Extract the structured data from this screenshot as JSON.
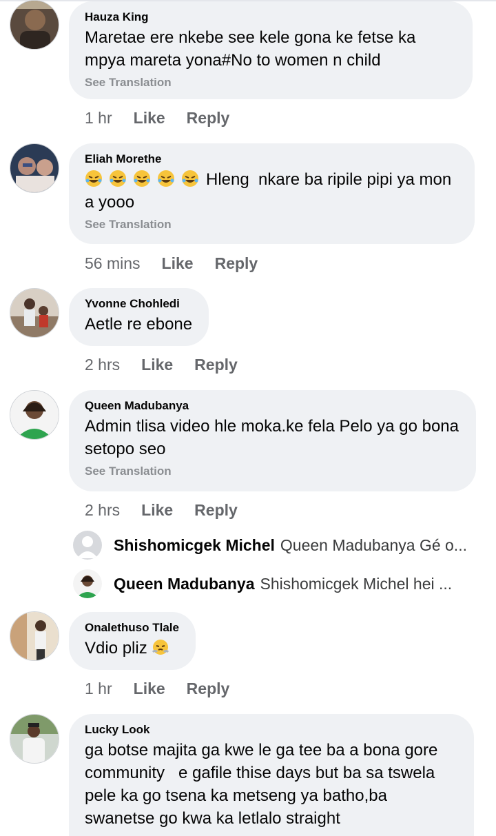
{
  "comments": [
    {
      "author": "Hauza King",
      "text": "Maretae ere nkebe see kele gona ke fetse ka mpya mareta yona#No to women n child",
      "see_translation": "See Translation",
      "time": "1 hr",
      "like": "Like",
      "reply": "Reply"
    },
    {
      "author": "Eliah Morethe",
      "emoji": [
        "rolling-on-floor-laughing",
        "rolling-on-floor-laughing",
        "rolling-on-floor-laughing",
        "rolling-on-floor-laughing",
        "rolling-on-floor-laughing"
      ],
      "text": "Hleng  nkare ba ripile pipi ya mon a yooo",
      "see_translation": "See Translation",
      "time": "56 mins",
      "like": "Like",
      "reply": "Reply"
    },
    {
      "author": "Yvonne Chohledi",
      "text": "Aetle re ebone",
      "time": "2 hrs",
      "like": "Like",
      "reply": "Reply"
    },
    {
      "author": "Queen Madubanya",
      "text": "Admin tlisa video hle moka.ke fela Pelo ya go bona setopo seo",
      "see_translation": "See Translation",
      "time": "2 hrs",
      "like": "Like",
      "reply": "Reply",
      "replies": [
        {
          "author": "Shishomicgek Michel",
          "text": "Queen Madubanya Gé o..."
        },
        {
          "author": "Queen Madubanya",
          "text": "Shishomicgek Michel hei ..."
        }
      ]
    },
    {
      "author": "Onalethuso Tlale",
      "text": "Vdio pliz",
      "emoji_after": "face-with-steam",
      "time": "1 hr",
      "like": "Like",
      "reply": "Reply"
    },
    {
      "author": "Lucky Look",
      "text": "ga botse majita ga kwe le ga tee ba a bona gore community   e gafile thise days but ba sa tswela pele ka go tsena ka metseng ya batho,ba swanetse go kwa ka letlalo straight"
    }
  ],
  "colors": {
    "bubble": "#eff1f4",
    "secondary_text": "#65676b",
    "see_translation": "#8a8d91"
  }
}
